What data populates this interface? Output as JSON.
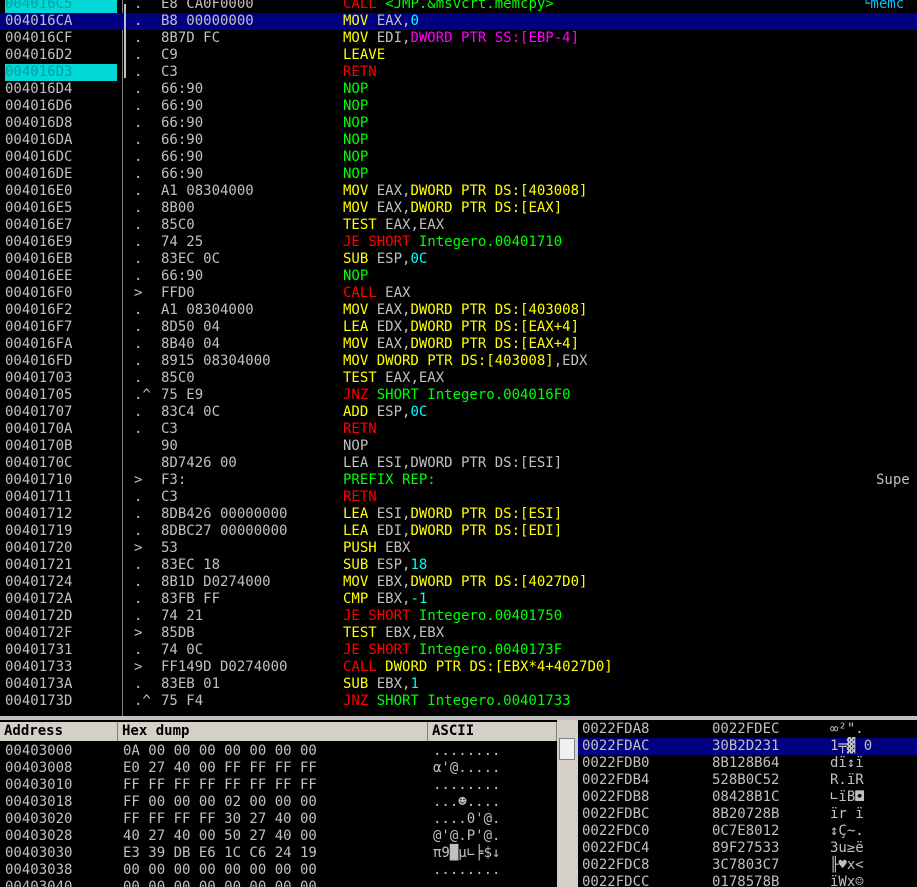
{
  "cpu": {
    "rows": [
      {
        "addr": "004016C5",
        "sym": ".",
        "hex": "E8 CA0F0000",
        "parts": [
          [
            "t-call",
            "CALL "
          ],
          [
            "t-green",
            "<JMP.&msvcrt.memcpy>"
          ]
        ],
        "comment": "└memc",
        "hl": true
      },
      {
        "addr": "004016CA",
        "sym": ".",
        "hex": "B8 00000000",
        "parts": [
          [
            "t-mov",
            "MOV "
          ],
          [
            "t-gray",
            "EAX,"
          ],
          [
            "t-cyan",
            "0"
          ]
        ],
        "sel": true
      },
      {
        "addr": "004016CF",
        "sym": ".",
        "hex": "8B7D FC",
        "parts": [
          [
            "t-mov",
            "MOV "
          ],
          [
            "t-gray",
            "EDI,"
          ],
          [
            "t-mag",
            "DWORD PTR SS:[EBP-4]"
          ]
        ]
      },
      {
        "addr": "004016D2",
        "sym": ".",
        "hex": "C9",
        "parts": [
          [
            "t-mov",
            "LEAVE"
          ]
        ]
      },
      {
        "addr": "004016D3",
        "sym": ".",
        "hex": "C3",
        "parts": [
          [
            "t-ret",
            "RETN"
          ]
        ],
        "hl": true
      },
      {
        "addr": "004016D4",
        "sym": ".",
        "hex": "66:90",
        "parts": [
          [
            "t-green",
            "NOP"
          ]
        ]
      },
      {
        "addr": "004016D6",
        "sym": ".",
        "hex": "66:90",
        "parts": [
          [
            "t-green",
            "NOP"
          ]
        ]
      },
      {
        "addr": "004016D8",
        "sym": ".",
        "hex": "66:90",
        "parts": [
          [
            "t-green",
            "NOP"
          ]
        ]
      },
      {
        "addr": "004016DA",
        "sym": ".",
        "hex": "66:90",
        "parts": [
          [
            "t-green",
            "NOP"
          ]
        ]
      },
      {
        "addr": "004016DC",
        "sym": ".",
        "hex": "66:90",
        "parts": [
          [
            "t-green",
            "NOP"
          ]
        ]
      },
      {
        "addr": "004016DE",
        "sym": ".",
        "hex": "66:90",
        "parts": [
          [
            "t-green",
            "NOP"
          ]
        ]
      },
      {
        "addr": "004016E0",
        "sym": ".",
        "hex": "A1 08304000",
        "parts": [
          [
            "t-mov",
            "MOV "
          ],
          [
            "t-gray",
            "EAX,"
          ],
          [
            "t-mov",
            "DWORD PTR DS:[403008]"
          ]
        ]
      },
      {
        "addr": "004016E5",
        "sym": ".",
        "hex": "8B00",
        "parts": [
          [
            "t-mov",
            "MOV "
          ],
          [
            "t-gray",
            "EAX,"
          ],
          [
            "t-mov",
            "DWORD PTR DS:[EAX]"
          ]
        ]
      },
      {
        "addr": "004016E7",
        "sym": ".",
        "hex": "85C0",
        "parts": [
          [
            "t-test",
            "TEST "
          ],
          [
            "t-gray",
            "EAX,EAX"
          ]
        ]
      },
      {
        "addr": "004016E9",
        "sym": ".",
        "hex": "74 25",
        "parts": [
          [
            "t-jmp",
            "JE SHORT "
          ],
          [
            "t-green",
            "Integero.00401710"
          ]
        ]
      },
      {
        "addr": "004016EB",
        "sym": ".",
        "hex": "83EC 0C",
        "parts": [
          [
            "t-mov",
            "SUB "
          ],
          [
            "t-gray",
            "ESP,"
          ],
          [
            "t-cyan",
            "0C"
          ]
        ]
      },
      {
        "addr": "004016EE",
        "sym": ".",
        "hex": "66:90",
        "parts": [
          [
            "t-green",
            "NOP"
          ]
        ]
      },
      {
        "addr": "004016F0",
        "sym": ">",
        "hex": "FFD0",
        "parts": [
          [
            "t-call",
            "CALL "
          ],
          [
            "t-gray",
            "EAX"
          ]
        ]
      },
      {
        "addr": "004016F2",
        "sym": ".",
        "hex": "A1 08304000",
        "parts": [
          [
            "t-mov",
            "MOV "
          ],
          [
            "t-gray",
            "EAX,"
          ],
          [
            "t-mov",
            "DWORD PTR DS:[403008]"
          ]
        ]
      },
      {
        "addr": "004016F7",
        "sym": ".",
        "hex": "8D50 04",
        "parts": [
          [
            "t-mov",
            "LEA "
          ],
          [
            "t-gray",
            "EDX,"
          ],
          [
            "t-mov",
            "DWORD PTR DS:[EAX+4]"
          ]
        ]
      },
      {
        "addr": "004016FA",
        "sym": ".",
        "hex": "8B40 04",
        "parts": [
          [
            "t-mov",
            "MOV "
          ],
          [
            "t-gray",
            "EAX,"
          ],
          [
            "t-mov",
            "DWORD PTR DS:[EAX+4]"
          ]
        ]
      },
      {
        "addr": "004016FD",
        "sym": ".",
        "hex": "8915 08304000",
        "parts": [
          [
            "t-mov",
            "MOV "
          ],
          [
            "t-mov",
            "DWORD PTR DS:[403008]"
          ],
          [
            "t-gray",
            ",EDX"
          ]
        ]
      },
      {
        "addr": "00401703",
        "sym": ".",
        "hex": "85C0",
        "parts": [
          [
            "t-test",
            "TEST "
          ],
          [
            "t-gray",
            "EAX,EAX"
          ]
        ]
      },
      {
        "addr": "00401705",
        "sym": ".^",
        "hex": "75 E9",
        "parts": [
          [
            "t-jmp",
            "JNZ "
          ],
          [
            "t-green",
            "SHORT Integero.004016F0"
          ]
        ]
      },
      {
        "addr": "00401707",
        "sym": ".",
        "hex": "83C4 0C",
        "parts": [
          [
            "t-mov",
            "ADD "
          ],
          [
            "t-gray",
            "ESP,"
          ],
          [
            "t-cyan",
            "0C"
          ]
        ]
      },
      {
        "addr": "0040170A",
        "sym": ".",
        "hex": "C3",
        "parts": [
          [
            "t-ret",
            "RETN"
          ]
        ]
      },
      {
        "addr": "0040170B",
        "sym": "",
        "hex": "90",
        "parts": [
          [
            "t-gray",
            "NOP"
          ]
        ]
      },
      {
        "addr": "0040170C",
        "sym": "",
        "hex": "8D7426 00",
        "parts": [
          [
            "t-gray",
            "LEA ESI,DWORD PTR DS:[ESI]"
          ]
        ]
      },
      {
        "addr": "00401710",
        "sym": ">",
        "hex": "F3:",
        "parts": [
          [
            "t-green",
            "PREFIX REP:"
          ]
        ],
        "comment": "Supe"
      },
      {
        "addr": "00401711",
        "sym": ".",
        "hex": "C3",
        "parts": [
          [
            "t-ret",
            "RETN"
          ]
        ]
      },
      {
        "addr": "00401712",
        "sym": ".",
        "hex": "8DB426 00000000",
        "parts": [
          [
            "t-mov",
            "LEA "
          ],
          [
            "t-gray",
            "ESI,"
          ],
          [
            "t-mov",
            "DWORD PTR DS:[ESI]"
          ]
        ]
      },
      {
        "addr": "00401719",
        "sym": ".",
        "hex": "8DBC27 00000000",
        "parts": [
          [
            "t-mov",
            "LEA "
          ],
          [
            "t-gray",
            "EDI,"
          ],
          [
            "t-mov",
            "DWORD PTR DS:[EDI]"
          ]
        ]
      },
      {
        "addr": "00401720",
        "sym": ">",
        "hex": "53",
        "parts": [
          [
            "t-mov",
            "PUSH "
          ],
          [
            "t-gray",
            "EBX"
          ]
        ]
      },
      {
        "addr": "00401721",
        "sym": ".",
        "hex": "83EC 18",
        "parts": [
          [
            "t-mov",
            "SUB "
          ],
          [
            "t-gray",
            "ESP,"
          ],
          [
            "t-cyan",
            "18"
          ]
        ]
      },
      {
        "addr": "00401724",
        "sym": ".",
        "hex": "8B1D D0274000",
        "parts": [
          [
            "t-mov",
            "MOV "
          ],
          [
            "t-gray",
            "EBX,"
          ],
          [
            "t-mov",
            "DWORD PTR DS:[4027D0]"
          ]
        ]
      },
      {
        "addr": "0040172A",
        "sym": ".",
        "hex": "83FB FF",
        "parts": [
          [
            "t-mov",
            "CMP "
          ],
          [
            "t-gray",
            "EBX,"
          ],
          [
            "t-cyan",
            "-1"
          ]
        ]
      },
      {
        "addr": "0040172D",
        "sym": ".",
        "hex": "74 21",
        "parts": [
          [
            "t-jmp",
            "JE SHORT "
          ],
          [
            "t-green",
            "Integero.00401750"
          ]
        ]
      },
      {
        "addr": "0040172F",
        "sym": ">",
        "hex": "85DB",
        "parts": [
          [
            "t-test",
            "TEST "
          ],
          [
            "t-gray",
            "EBX,EBX"
          ]
        ]
      },
      {
        "addr": "00401731",
        "sym": ".",
        "hex": "74 0C",
        "parts": [
          [
            "t-jmp",
            "JE SHORT "
          ],
          [
            "t-green",
            "Integero.0040173F"
          ]
        ]
      },
      {
        "addr": "00401733",
        "sym": ">",
        "hex": "FF149D D0274000",
        "parts": [
          [
            "t-call",
            "CALL "
          ],
          [
            "t-mov",
            "DWORD PTR DS:[EBX*4+4027D0]"
          ]
        ]
      },
      {
        "addr": "0040173A",
        "sym": ".",
        "hex": "83EB 01",
        "parts": [
          [
            "t-mov",
            "SUB "
          ],
          [
            "t-gray",
            "EBX,"
          ],
          [
            "t-cyan",
            "1"
          ]
        ]
      },
      {
        "addr": "0040173D",
        "sym": ".^",
        "hex": "75 F4",
        "parts": [
          [
            "t-jmp",
            "JNZ "
          ],
          [
            "t-green",
            "SHORT Integero.00401733"
          ]
        ]
      }
    ]
  },
  "dump": {
    "headers": {
      "address": "Address",
      "hex": "Hex dump",
      "ascii": "ASCII"
    },
    "rows": [
      {
        "a": "00403000",
        "h": "0A 00 00 00 00 00 00 00",
        "s": "........"
      },
      {
        "a": "00403008",
        "h": "E0 27 40 00 FF FF FF FF",
        "s": "α'@....."
      },
      {
        "a": "00403010",
        "h": "FF FF FF FF FF FF FF FF",
        "s": "........"
      },
      {
        "a": "00403018",
        "h": "FF 00 00 00 02 00 00 00",
        "s": "...☻...."
      },
      {
        "a": "00403020",
        "h": "FF FF FF FF 30 27 40 00",
        "s": "....0'@."
      },
      {
        "a": "00403028",
        "h": "40 27 40 00 50 27 40 00",
        "s": "@'@.P'@."
      },
      {
        "a": "00403030",
        "h": "E3 39 DB E6 1C C6 24 19",
        "s": "π9█μ∟╞$↓"
      },
      {
        "a": "00403038",
        "h": "00 00 00 00 00 00 00 00",
        "s": "........"
      },
      {
        "a": "00403040",
        "h": "00 00 00 00 00 00 00 00",
        "s": "........"
      }
    ]
  },
  "stack": {
    "rows": [
      {
        "a": "0022FDA8",
        "v": "0022FDEC",
        "c": "∞²\"."
      },
      {
        "a": "0022FDAC",
        "v": "30B2D231",
        "c": "1╤▓ 0",
        "sel": true
      },
      {
        "a": "0022FDB0",
        "v": "8B128B64",
        "c": "dï↕ï"
      },
      {
        "a": "0022FDB4",
        "v": "528B0C52",
        "c": "R.ïR"
      },
      {
        "a": "0022FDB8",
        "v": "08428B1C",
        "c": "∟ïB◘"
      },
      {
        "a": "0022FDBC",
        "v": "8B20728B",
        "c": "ïr ï"
      },
      {
        "a": "0022FDC0",
        "v": "0C7E8012",
        "c": "↕Ç~."
      },
      {
        "a": "0022FDC4",
        "v": "89F27533",
        "c": "3u≥ë"
      },
      {
        "a": "0022FDC8",
        "v": "3C7803C7",
        "c": "╟♥x<"
      },
      {
        "a": "0022FDCC",
        "v": "0178578B",
        "c": "ïWx☺"
      }
    ]
  }
}
